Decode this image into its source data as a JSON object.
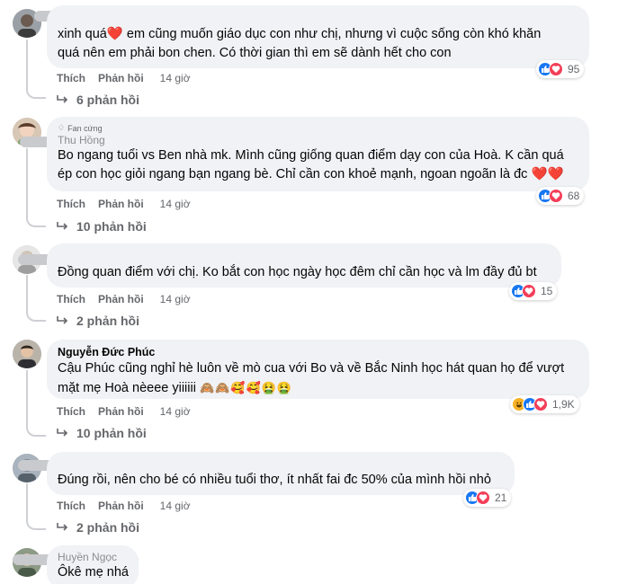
{
  "comments": [
    {
      "author": "",
      "text_lines": [
        "xinh quá",
        " em cũng muốn giáo dục con như chị, nhưng vì cuộc sống còn khó khăn",
        "quá nên em phải bon chen. Có thời gian thì em sẽ dành hết cho con"
      ],
      "heart": "❤️",
      "like_label": "Thích",
      "reply_label": "Phản hồi",
      "time": "14 giờ",
      "reaction_count": "95",
      "replies_label": "6 phản hồi"
    },
    {
      "badge": "Fan cứng",
      "author": "Thu Hồng",
      "text_lines": [
        "Bo ngang tuổi vs Ben nhà mk. Mình cũng giống quan điểm dạy con của Hoà. K cần quá",
        "ép con học giỏi ngang bạn ngang bè. Chỉ cần con khoẻ mạnh, ngoan ngoãn là đc "
      ],
      "hearts": "❤️❤️",
      "like_label": "Thích",
      "reply_label": "Phản hồi",
      "time": "14 giờ",
      "reaction_count": "68",
      "replies_label": "10 phản hồi"
    },
    {
      "author": "",
      "text_lines": [
        "Đồng quan điểm với chị. Ko bắt con học ngày học đêm chỉ cần học và lm đầy đủ bt"
      ],
      "like_label": "Thích",
      "reply_label": "Phản hồi",
      "time": "14 giờ",
      "reaction_count": "15",
      "replies_label": "2 phản hồi"
    },
    {
      "author": "Nguyễn Đức Phúc",
      "text_lines": [
        "Cậu Phúc cũng nghỉ hè luôn về mò cua với Bo và về Bắc Ninh học hát quan họ để vượt",
        "mặt mẹ Hoà nèeee yiiiiii "
      ],
      "emojis": "🙈🙈🥰🥰🤮🤮",
      "like_label": "Thích",
      "reply_label": "Phản hồi",
      "time": "14 giờ",
      "reaction_count": "1,9K",
      "replies_label": "10 phản hồi"
    },
    {
      "author": "",
      "text_lines": [
        "Đúng rồi, nên cho bé có nhiều tuổi thơ, ít nhất fai đc 50% của mình hồi nhỏ"
      ],
      "like_label": "Thích",
      "reply_label": "Phản hồi",
      "time": "14 giờ",
      "reaction_count": "21",
      "replies_label": "2 phản hồi"
    },
    {
      "author": "Huyền Ngọc",
      "text_lines": [
        "Ôkê mẹ nhá"
      ]
    }
  ],
  "colors": {
    "bubble": "#f0f2f5",
    "meta": "#65676b",
    "like": "#1877f2",
    "love": "#f33e58",
    "haha": "#f7b125"
  }
}
